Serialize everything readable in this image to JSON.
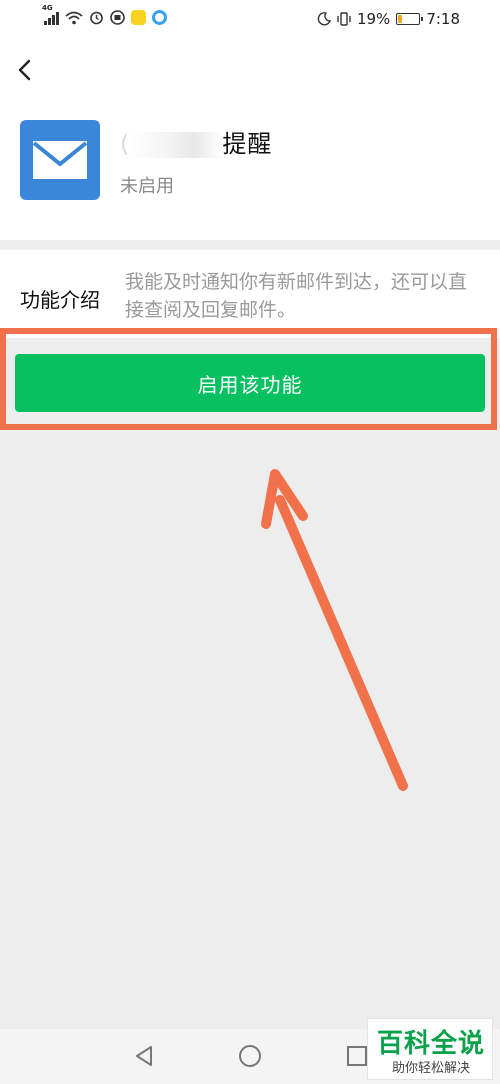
{
  "status_bar": {
    "network": "4G",
    "battery_percent": "19%",
    "battery_level": 0.19,
    "time": "7:18",
    "battery_color": "#f5a623"
  },
  "header": {
    "back_icon": "chevron-left-icon",
    "app_icon": "envelope-icon",
    "app_icon_color": "#3a86d9",
    "plugin_name_prefix": "(",
    "plugin_name_visible": "提醒",
    "plugin_status": "未启用"
  },
  "intro": {
    "label": "功能介绍",
    "description": "我能及时通知你有新邮件到达，还可以直接查阅及回复邮件。"
  },
  "actions": {
    "enable_label": "启用该功能",
    "enable_color": "#07c160"
  },
  "annotation": {
    "highlight_color": "#f0714a"
  },
  "nav_bar": {
    "back_icon": "triangle-back-icon",
    "home_icon": "circle-home-icon",
    "recent_icon": "square-recent-icon"
  },
  "watermark": {
    "title": "百科全说",
    "subtitle": "助你轻松解决"
  }
}
